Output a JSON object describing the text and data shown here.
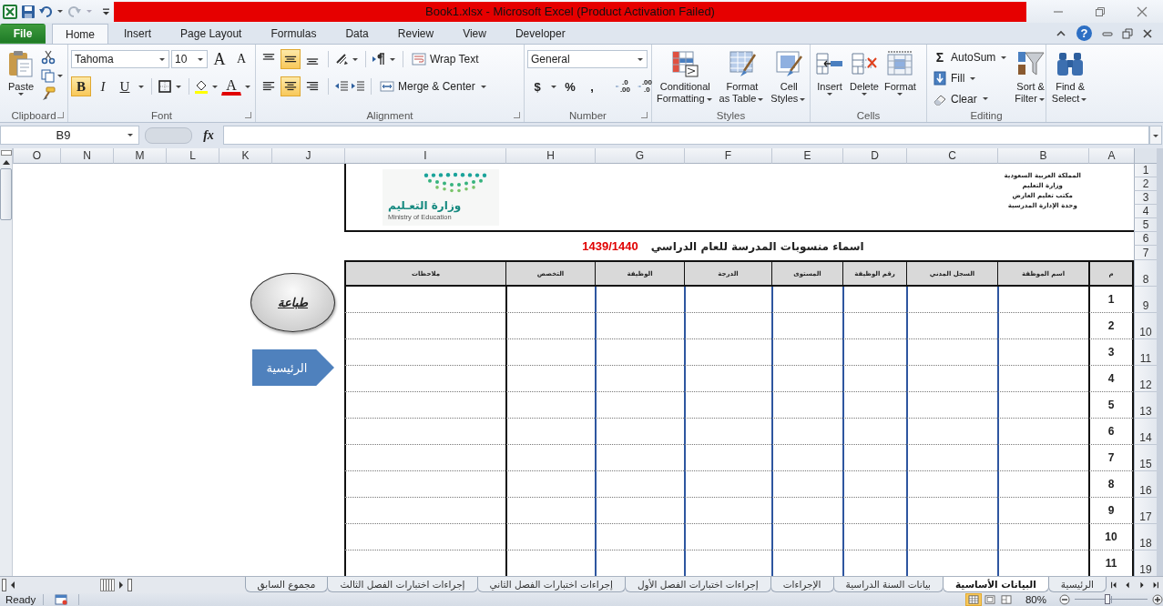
{
  "title_bar": {
    "title": "Book1.xlsx  -  Microsoft Excel (Product Activation Failed)"
  },
  "ribbon_tabs": {
    "file": {
      "label": "File",
      "selected": false
    },
    "home": {
      "label": "Home",
      "selected": true
    },
    "insert": {
      "label": "Insert",
      "selected": false
    },
    "page_layout": {
      "label": "Page Layout",
      "selected": false
    },
    "formulas": {
      "label": "Formulas",
      "selected": false
    },
    "data": {
      "label": "Data",
      "selected": false
    },
    "review": {
      "label": "Review",
      "selected": false
    },
    "view": {
      "label": "View",
      "selected": false
    },
    "developer": {
      "label": "Developer",
      "selected": false
    }
  },
  "help_glyph": "?",
  "clipboard": {
    "label": "Clipboard",
    "paste": "Paste"
  },
  "font": {
    "label": "Font",
    "family": "Tahoma",
    "size": "10",
    "grow": "A",
    "shrink": "A",
    "font_color_glyph": "A",
    "styles": {
      "bold": {
        "glyph": "B",
        "selected": true
      },
      "italic": {
        "glyph": "I",
        "selected": false
      },
      "underline": {
        "glyph": "U",
        "selected": false
      }
    }
  },
  "alignment": {
    "label": "Alignment",
    "wrap_text": "Wrap Text",
    "merge_center": "Merge & Center",
    "vertical": [
      {
        "kind": "top",
        "selected": false
      },
      {
        "kind": "middle",
        "selected": true
      },
      {
        "kind": "bottom",
        "selected": false
      }
    ],
    "horizontal": [
      {
        "kind": "left",
        "selected": false
      },
      {
        "kind": "center",
        "selected": true
      },
      {
        "kind": "right",
        "selected": false
      }
    ]
  },
  "number": {
    "label": "Number",
    "format": "General",
    "currency": "$",
    "percent": "%",
    "comma": ",",
    "increase_decimal": [
      ".0",
      ".00"
    ],
    "decrease_decimal": [
      ".00",
      ".0"
    ]
  },
  "styles": {
    "label": "Styles",
    "buttons": {
      "conditional": {
        "lines": [
          "Conditional",
          "Formatting"
        ]
      },
      "table": {
        "lines": [
          "Format",
          "as Table"
        ]
      },
      "cell": {
        "lines": [
          "Cell",
          "Styles"
        ]
      }
    }
  },
  "cells": {
    "label": "Cells",
    "buttons": {
      "insert": {
        "label": "Insert"
      },
      "delete": {
        "label": "Delete"
      },
      "format": {
        "label": "Format"
      }
    }
  },
  "editing": {
    "label": "Editing",
    "sigma": "Σ",
    "autosum": "AutoSum",
    "fill": "Fill",
    "clear": "Clear",
    "sort": [
      "Sort &",
      "Filter"
    ],
    "find": [
      "Find &",
      "Select"
    ]
  },
  "formula_bar": {
    "name_box": "B9",
    "fx": "fx"
  },
  "sheet": {
    "column_headers": [
      "A",
      "B",
      "C",
      "D",
      "E",
      "F",
      "G",
      "H",
      "I",
      "J",
      "K",
      "L",
      "M",
      "N",
      "O"
    ],
    "row_numbers": [
      "1",
      "2",
      "3",
      "4",
      "5",
      "6",
      "7",
      "8",
      "9",
      "10",
      "11",
      "12",
      "13",
      "14",
      "15",
      "16",
      "17",
      "18",
      "19"
    ],
    "letterhead": {
      "lines": [
        "المملكة العربية السعودية",
        "وزارة التعليم",
        "مكتب تعليم العارض",
        "وحدة الإدارة المدرسية"
      ],
      "logo_arabic": "وزارة التعـليم",
      "logo_english": "Ministry of Education"
    },
    "heading": {
      "text": "اسماء منسوبات المدرسة للعام الدراسي",
      "year": "1439/1440"
    },
    "table": {
      "columns": [
        "م",
        "اسم الموظفة",
        "السجل المدني",
        "رقم الوظيفة",
        "المستوى",
        "الدرجة",
        "الوظيفة",
        "التخصص",
        "ملاحظات"
      ],
      "rows": [
        {
          "number": "1"
        },
        {
          "number": "2"
        },
        {
          "number": "3"
        },
        {
          "number": "4"
        },
        {
          "number": "5"
        },
        {
          "number": "6"
        },
        {
          "number": "7"
        },
        {
          "number": "8"
        },
        {
          "number": "9"
        },
        {
          "number": "10"
        },
        {
          "number": "11"
        }
      ]
    },
    "shapes": [
      {
        "kind": "oval",
        "label": "طباعة"
      },
      {
        "kind": "pentagon",
        "label": "الرئيسية"
      }
    ]
  },
  "sheet_tabs": [
    {
      "label": "الرئيسية",
      "selected": false
    },
    {
      "label": "البيانات الأساسية",
      "selected": true
    },
    {
      "label": "بيانات السنة الدراسية",
      "selected": false
    },
    {
      "label": "الإجراءات",
      "selected": false
    },
    {
      "label": "إجراءات اختبارات الفصل الأول",
      "selected": false
    },
    {
      "label": "إجراءات اختبارات الفصل الثاني",
      "selected": false
    },
    {
      "label": "إجراءات اختبارات الفصل الثالث",
      "selected": false
    },
    {
      "label": "مجموع السابق",
      "selected": false
    }
  ],
  "status_bar": {
    "mode": "Ready",
    "views": [
      {
        "kind": "normal",
        "selected": true
      },
      {
        "kind": "page_layout",
        "selected": false
      },
      {
        "kind": "page_break",
        "selected": false
      }
    ],
    "zoom": {
      "reading": "80%",
      "level": 0.45
    }
  }
}
